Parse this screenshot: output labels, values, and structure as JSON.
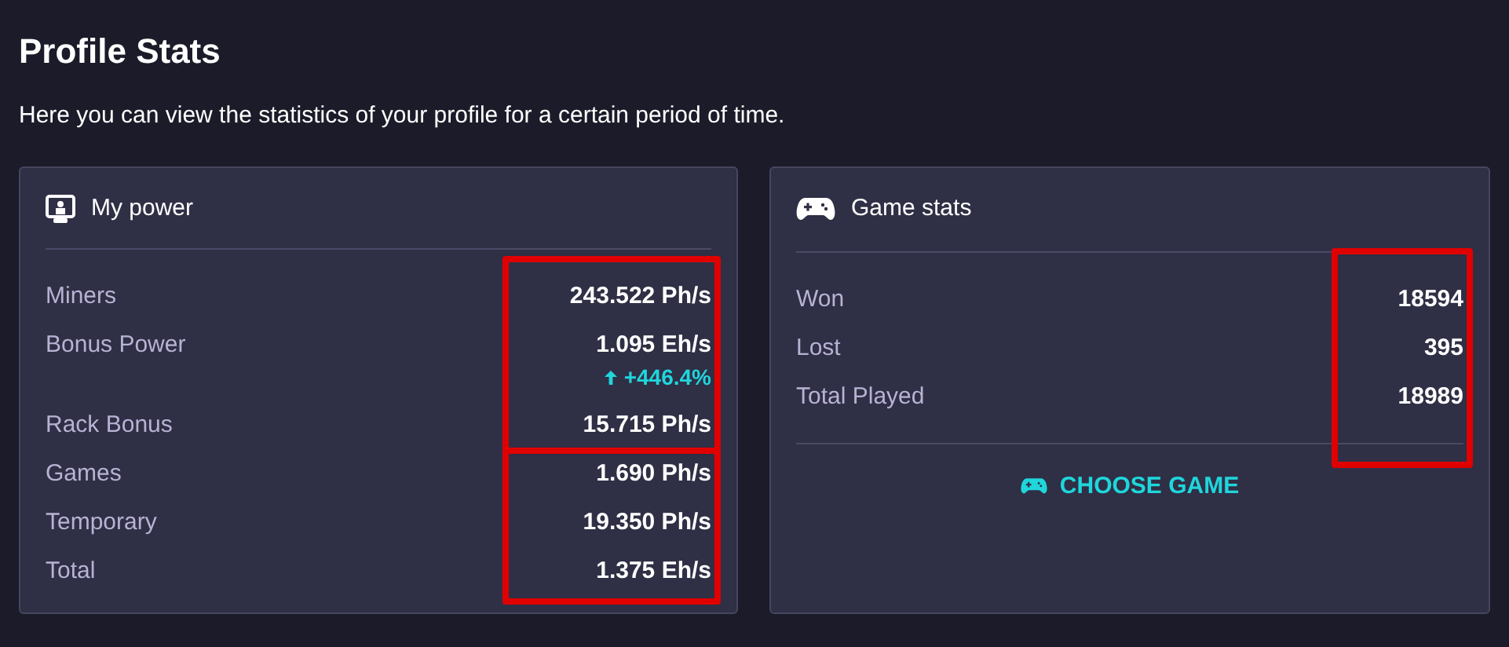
{
  "title": "Profile Stats",
  "subtitle": "Here you can view the statistics of your profile for a certain period of time.",
  "power_card": {
    "title": "My power",
    "groups": [
      {
        "highlighted": true,
        "rows": [
          {
            "label": "Miners",
            "value": "243.522 Ph/s"
          },
          {
            "label": "Bonus Power",
            "value": "1.095 Eh/s",
            "change": "+446.4%"
          },
          {
            "label": "Rack Bonus",
            "value": "15.715 Ph/s"
          }
        ]
      },
      {
        "highlighted": true,
        "rows": [
          {
            "label": "Games",
            "value": "1.690 Ph/s"
          },
          {
            "label": "Temporary",
            "value": "19.350 Ph/s"
          },
          {
            "label": "Total",
            "value": "1.375 Eh/s"
          }
        ]
      }
    ]
  },
  "game_card": {
    "title": "Game stats",
    "groups": [
      {
        "highlighted": true,
        "rows": [
          {
            "label": "Won",
            "value": "18594"
          },
          {
            "label": "Lost",
            "value": "395"
          },
          {
            "label": "Total Played",
            "value": "18989"
          }
        ]
      }
    ],
    "button": "CHOOSE GAME"
  }
}
